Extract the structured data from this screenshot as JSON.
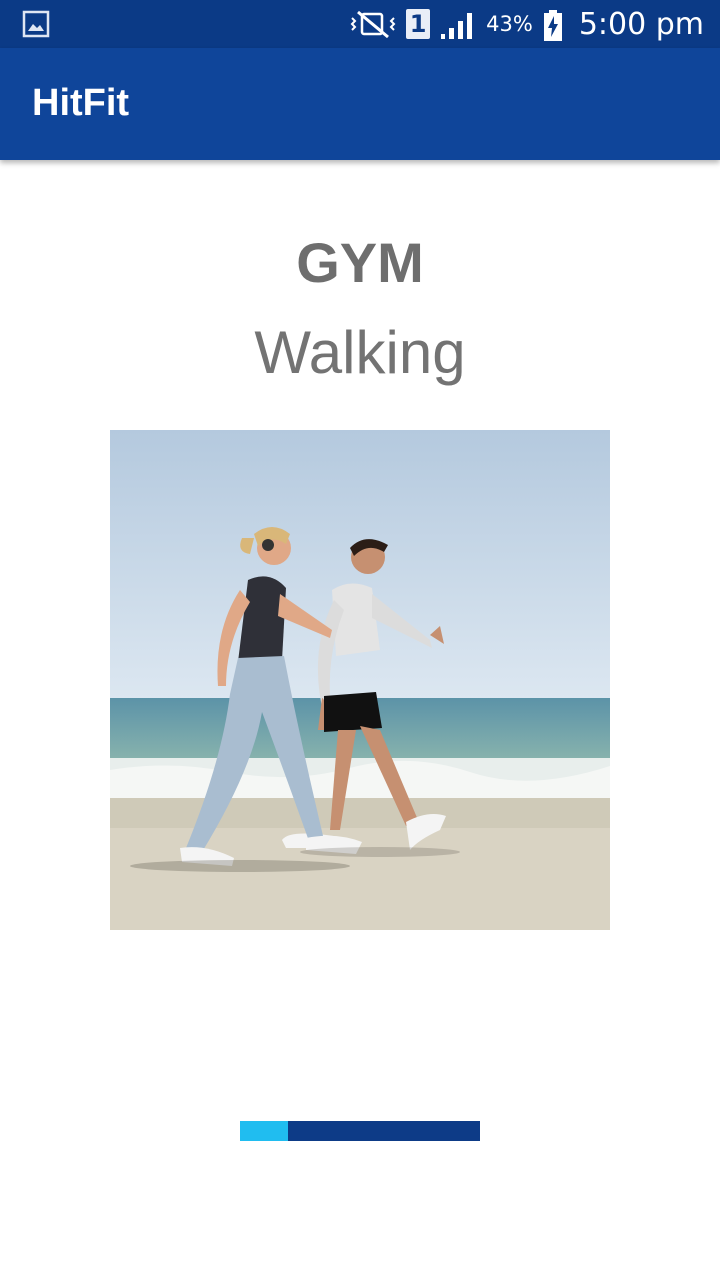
{
  "status_bar": {
    "left_icon": "gallery-notification-icon",
    "icons": [
      "vibrate-mute-icon",
      "sim-1-icon",
      "signal-icon",
      "battery-charging-icon"
    ],
    "sim_label": "1",
    "battery_percent": "43%",
    "time": "5:00 pm"
  },
  "app_bar": {
    "title": "HitFit",
    "color": "#0f459a"
  },
  "workout": {
    "category": "GYM",
    "exercise": "Walking",
    "image": "couple-walking-on-beach-photo"
  },
  "progress": {
    "value": 0.2,
    "track_color": "#0d3b87",
    "fill_color": "#20bdf0"
  }
}
